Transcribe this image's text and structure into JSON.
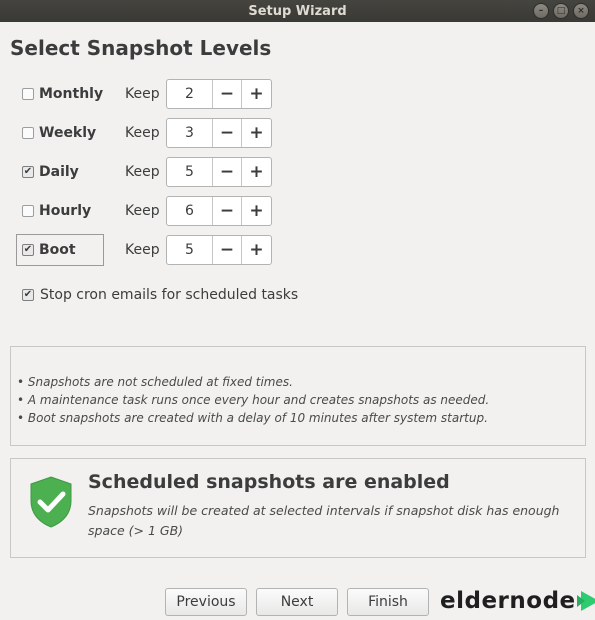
{
  "window": {
    "title": "Setup Wizard"
  },
  "page": {
    "title": "Select Snapshot Levels"
  },
  "levels": [
    {
      "label": "Monthly",
      "checked": false,
      "keep_label": "Keep",
      "value": "2"
    },
    {
      "label": "Weekly",
      "checked": false,
      "keep_label": "Keep",
      "value": "3"
    },
    {
      "label": "Daily",
      "checked": true,
      "keep_label": "Keep",
      "value": "5"
    },
    {
      "label": "Hourly",
      "checked": false,
      "keep_label": "Keep",
      "value": "6"
    },
    {
      "label": "Boot",
      "checked": true,
      "keep_label": "Keep",
      "value": "5"
    }
  ],
  "spin": {
    "minus": "−",
    "plus": "+"
  },
  "cron": {
    "label": "Stop cron emails for scheduled tasks",
    "checked": true
  },
  "notes": [
    "• Snapshots are not scheduled at fixed times.",
    "• A maintenance task runs once every hour and creates snapshots as needed.",
    "• Boot snapshots are created with a delay of 10 minutes after system startup."
  ],
  "status": {
    "title": "Scheduled snapshots are enabled",
    "message": "Snapshots will be created at selected intervals if snapshot disk has enough space (> 1 GB)",
    "color": "#4caf50"
  },
  "buttons": {
    "previous": "Previous",
    "next": "Next",
    "finish": "Finish"
  },
  "watermark": {
    "text": "eldernode",
    "color": "#2ecc71"
  }
}
